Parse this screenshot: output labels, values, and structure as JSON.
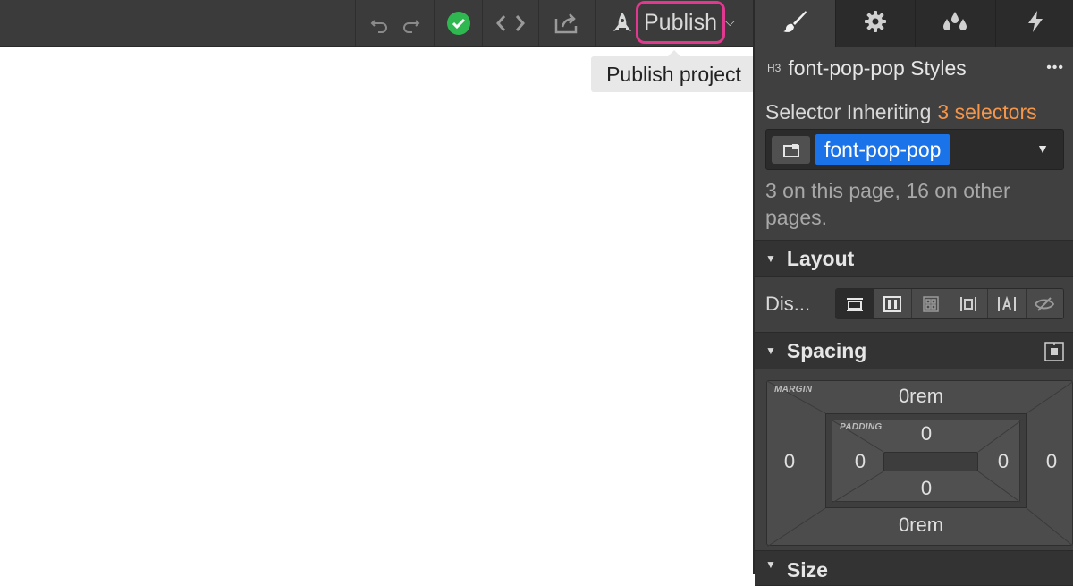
{
  "toolbar": {
    "publish_label": "Publish",
    "tooltip": "Publish project"
  },
  "panel": {
    "tabs": [
      "style-tab",
      "settings-tab",
      "interactions-tab",
      "lightning-tab"
    ],
    "element_tag": "H3",
    "element_title": "font-pop-pop Styles",
    "more_label": "•••",
    "selector_label": "Selector Inheriting",
    "selector_count": "3 selectors",
    "selector_value": "font-pop-pop",
    "usage_text_line1": "3 on this page, 16 on other",
    "usage_text_line2": "pages.",
    "layout_title": "Layout",
    "display_label": "Dis...",
    "spacing_title": "Spacing",
    "margin_label": "MARGIN",
    "padding_label": "PADDING",
    "margin_top": "0rem",
    "margin_bottom": "0rem",
    "margin_left": "0",
    "margin_right": "0",
    "padding_top": "0",
    "padding_bottom": "0",
    "padding_left": "0",
    "padding_right": "0",
    "size_title": "Size"
  },
  "colors": {
    "accent_orange": "#f5964a",
    "selector_blue": "#1a73e8",
    "highlight_pink": "#e0398f",
    "check_green": "#2fb84f"
  }
}
